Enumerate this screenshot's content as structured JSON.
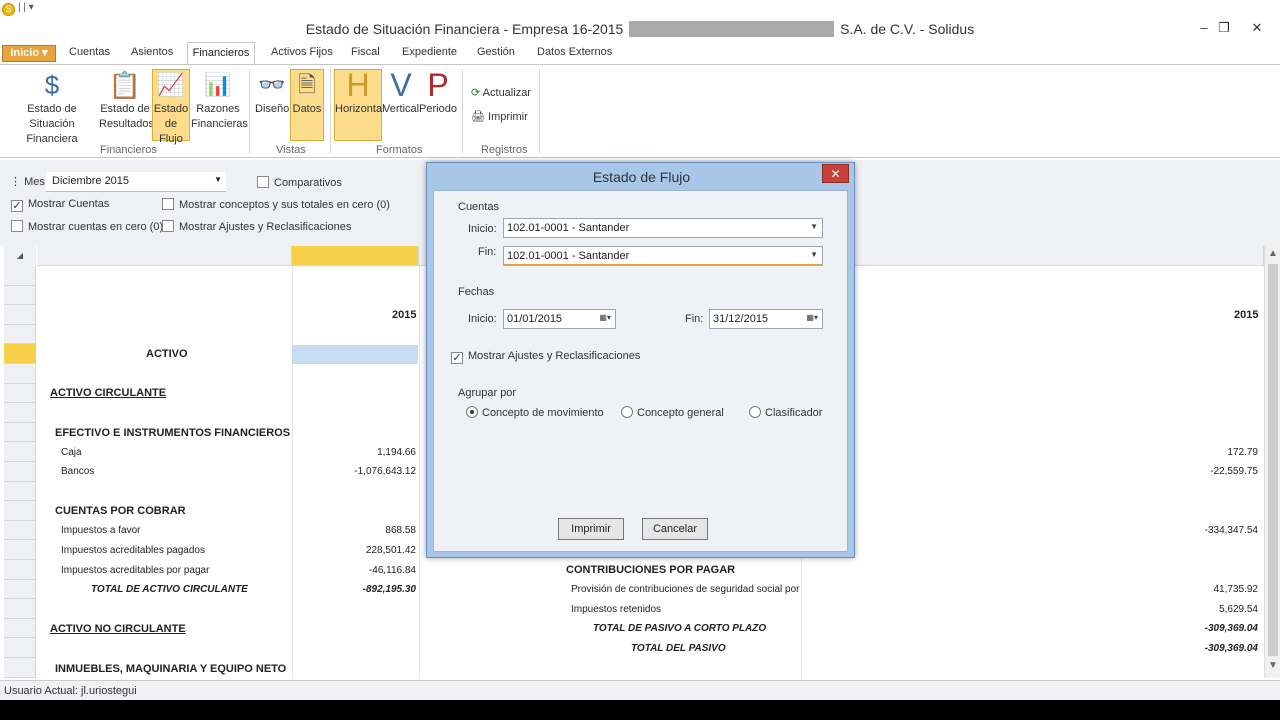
{
  "window": {
    "title_left": "Estado de Situación Financiera - Empresa 16-2015",
    "title_right": "S.A. de C.V. - Solidus"
  },
  "ribbon": {
    "inicio": "Inicio",
    "tabs": [
      "Cuentas",
      "Asientos",
      "Financieros",
      "Activos Fijos",
      "Fiscal",
      "Expediente",
      "Gestión",
      "Datos Externos"
    ],
    "financieros": [
      {
        "l1": "Estado de Situación",
        "l2": "Financiera"
      },
      {
        "l1": "Estado de",
        "l2": "Resultados"
      },
      {
        "l1": "Estado",
        "l2": "de Flujo"
      },
      {
        "l1": "Razones",
        "l2": "Financieras"
      }
    ],
    "vistas": [
      "Diseño",
      "Datos"
    ],
    "formatos": [
      "Horizontal",
      "Vertical",
      "Periodo"
    ],
    "formatos_letters": [
      "H",
      "V",
      "P"
    ],
    "registros": [
      "Actualizar",
      "Imprimir"
    ],
    "groups": [
      "Financieros",
      "Vistas",
      "Formatos",
      "Registros"
    ]
  },
  "filters": {
    "mes_label": "Mes",
    "mes_value": "Diciembre 2015",
    "comparativos": "Comparativos",
    "mostrar_cuentas": "Mostrar Cuentas",
    "mostrar_conceptos": "Mostrar conceptos  y sus totales en cero (0)",
    "mostrar_cuentas_cero": "Mostrar cuentas en cero (0)",
    "mostrar_ajustes": "Mostrar Ajustes y Reclasificaciones"
  },
  "grid": {
    "year_left": "2015",
    "year_right": "2015",
    "activo": "ACTIVO",
    "activo_circulante": "ACTIVO CIRCULANTE",
    "efectivo": "EFECTIVO E INSTRUMENTOS FINANCIEROS",
    "caja": "Caja",
    "caja_val": "1,194.66",
    "bancos": "Bancos",
    "bancos_val": "-1,076,643.12",
    "cuentas_cobrar": "CUENTAS POR COBRAR",
    "imp_favor": "Impuestos a favor",
    "imp_favor_val": "868.58",
    "imp_acred_pag": "Impuestos acreditables pagados",
    "imp_acred_pag_val": "228,501.42",
    "imp_acred_por": "Impuestos acreditables por pagar",
    "imp_acred_por_val": "-46,116.84",
    "total_activo_circ": "TOTAL DE ACTIVO CIRCULANTE",
    "total_activo_circ_val": "-892,195.30",
    "activo_no_circ": "ACTIVO NO CIRCULANTE",
    "inmuebles": "INMUEBLES, MAQUINARIA Y EQUIPO NETO",
    "right_1": "172.79",
    "right_2": "-22,559.75",
    "right_3": "-334,347.54",
    "contribuciones": "CONTRIBUCIONES POR PAGAR",
    "provision": "Provisión de contribuciones de seguridad social por p",
    "provision_val": "41,735.92",
    "imp_retenidos": "Impuestos retenidos",
    "imp_retenidos_val": "5,629.54",
    "total_pasivo_cp": "TOTAL DE PASIVO A CORTO PLAZO",
    "total_pasivo_cp_val": "-309,369.04",
    "total_pasivo": "TOTAL DEL PASIVO",
    "total_pasivo_val": "-309,369.04"
  },
  "status": {
    "usuario": "Usuario Actual: jl.uriostegui"
  },
  "dialog": {
    "title": "Estado de Flujo",
    "close": "✕",
    "cuentas": "Cuentas",
    "inicio_label": "Inicio:",
    "inicio_value": "102.01-0001 - Santander",
    "fin_label": "Fin:",
    "fin_value": "102.01-0001 - Santander",
    "fechas": "Fechas",
    "fecha_inicio_label": "Inicio:",
    "fecha_inicio": "01/01/2015",
    "fecha_fin_label": "Fin:",
    "fecha_fin": "31/12/2015",
    "mostrar_ajustes": "Mostrar Ajustes y Reclasificaciones",
    "agrupar": "Agrupar por",
    "opt1": "Concepto de movimiento",
    "opt2": "Concepto general",
    "opt3": "Clasificador",
    "imprimir": "Imprimir",
    "cancelar": "Cancelar"
  }
}
